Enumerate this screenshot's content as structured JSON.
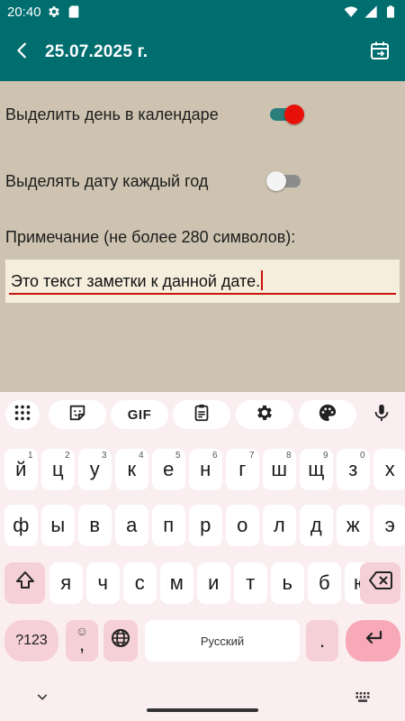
{
  "status_bar": {
    "time": "20:40",
    "icons": [
      "gear-icon",
      "sd-card-icon",
      "wifi-icon",
      "signal-icon",
      "battery-icon"
    ]
  },
  "app_bar": {
    "title": "25.07.2025 г.",
    "back_icon": "arrow-back-icon",
    "action_icon": "calendar-arrow-icon"
  },
  "content": {
    "highlight_day_label": "Выделить день в календаре",
    "highlight_day_on": true,
    "highlight_yearly_label": "Выделять дату каждый год",
    "highlight_yearly_on": false,
    "note_label": "Примечание (не более 280 символов):",
    "note_value": "Это текст заметки к данной дате."
  },
  "keyboard": {
    "toolbar": [
      "grid-icon",
      "sticker-icon",
      "GIF",
      "clipboard-icon",
      "gear-icon",
      "palette-icon",
      "mic-icon"
    ],
    "gif_label": "GIF",
    "row1": [
      {
        "k": "й",
        "h": "1"
      },
      {
        "k": "ц",
        "h": "2"
      },
      {
        "k": "у",
        "h": "3"
      },
      {
        "k": "к",
        "h": "4"
      },
      {
        "k": "е",
        "h": "5"
      },
      {
        "k": "н",
        "h": "6"
      },
      {
        "k": "г",
        "h": "7"
      },
      {
        "k": "ш",
        "h": "8"
      },
      {
        "k": "щ",
        "h": "9"
      },
      {
        "k": "з",
        "h": "0"
      },
      {
        "k": "х",
        "h": ""
      }
    ],
    "row2": [
      "ф",
      "ы",
      "в",
      "а",
      "п",
      "р",
      "о",
      "л",
      "д",
      "ж",
      "э"
    ],
    "row3": [
      "я",
      "ч",
      "с",
      "м",
      "и",
      "т",
      "ь",
      "б",
      "ю"
    ],
    "symbols_label": "?123",
    "comma_label": ",",
    "emoji_hint": "☺",
    "space_label": "Русский",
    "period_label": "."
  },
  "colors": {
    "primary": "#006d6f",
    "background": "#cdc3b0",
    "note_background": "#f5eedd",
    "accent_red": "#e8110a",
    "keyboard_bg": "#fbeef0"
  }
}
